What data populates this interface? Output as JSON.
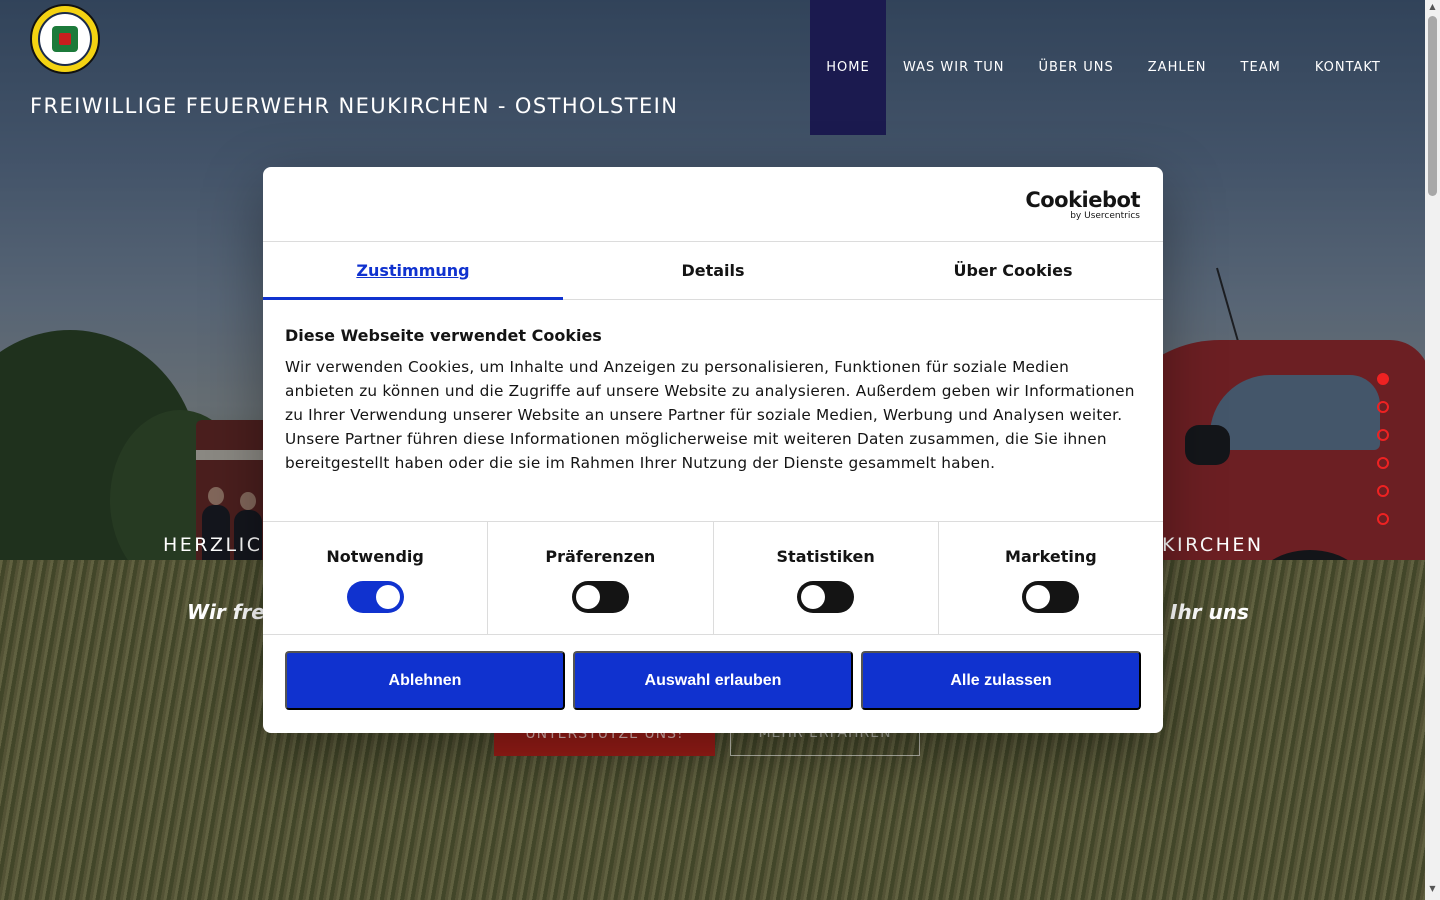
{
  "site": {
    "title": "FREIWILLIGE FEUERWEHR NEUKIRCHEN - OSTHOLSTEIN"
  },
  "nav": {
    "items": [
      {
        "label": "HOME",
        "active": true
      },
      {
        "label": "WAS WIR TUN",
        "active": false
      },
      {
        "label": "ÜBER UNS",
        "active": false
      },
      {
        "label": "ZAHLEN",
        "active": false
      },
      {
        "label": "TEAM",
        "active": false
      },
      {
        "label": "KONTAKT",
        "active": false
      }
    ],
    "active_color": "#1b1a4f"
  },
  "hero": {
    "heading_left": "HERZLIC",
    "heading_right": "KIRCHEN",
    "subtitle_left": "Wir freu",
    "subtitle_right": "Ihr uns",
    "cta_support": "UNTERSTÜTZE UNS!",
    "cta_more": "MEHR ERFAHREN",
    "slides": 6,
    "active_slide": 1,
    "accent_color": "#e22222"
  },
  "cookie": {
    "brand": "Cookiebot",
    "brand_by": "by Usercentrics",
    "tabs": [
      {
        "label": "Zustimmung",
        "active": true
      },
      {
        "label": "Details",
        "active": false
      },
      {
        "label": "Über Cookies",
        "active": false
      }
    ],
    "heading": "Diese Webseite verwendet Cookies",
    "text": "Wir verwenden Cookies, um Inhalte und Anzeigen zu personalisieren, Funktionen für soziale Medien anbieten zu können und die Zugriffe auf unsere Website zu analysieren. Außerdem geben wir Informationen zu Ihrer Verwendung unserer Website an unsere Partner für soziale Medien, Werbung und Analysen weiter. Unsere Partner führen diese Informationen möglicherweise mit weiteren Daten zusammen, die Sie ihnen bereitgestellt haben oder die sie im Rahmen Ihrer Nutzung der Dienste gesammelt haben.",
    "toggles": [
      {
        "label": "Notwendig",
        "on": true
      },
      {
        "label": "Präferenzen",
        "on": false
      },
      {
        "label": "Statistiken",
        "on": false
      },
      {
        "label": "Marketing",
        "on": false
      }
    ],
    "buttons": {
      "decline": "Ablehnen",
      "allow_selection": "Auswahl erlauben",
      "allow_all": "Alle zulassen"
    },
    "primary_color": "#1032cf"
  }
}
